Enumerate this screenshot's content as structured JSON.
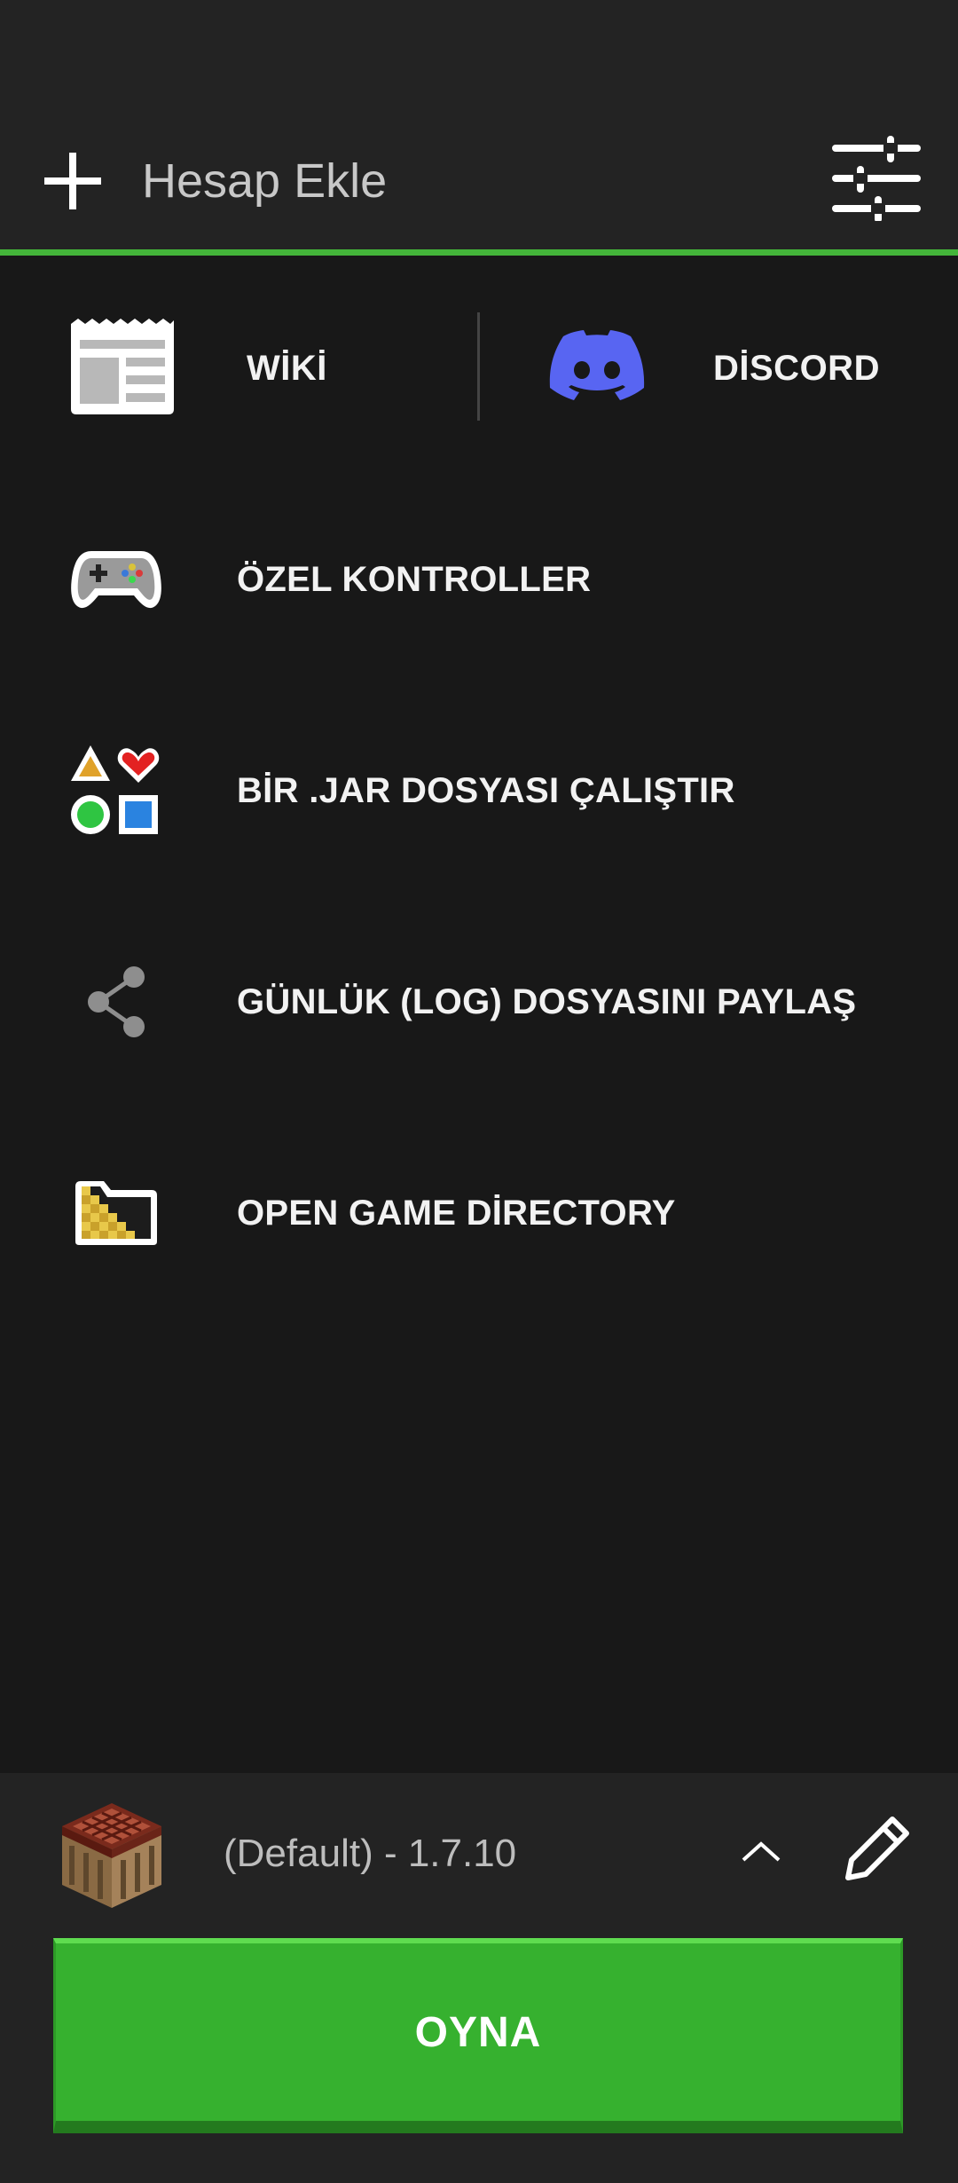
{
  "header": {
    "add_account_label": "Hesap Ekle",
    "accent_color": "#44b53a"
  },
  "quick_links": {
    "wiki_label": "WİKİ",
    "discord_label": "DİSCORD"
  },
  "menu": {
    "items": [
      {
        "label": "ÖZEL KONTROLLER",
        "icon": "gamepad-icon"
      },
      {
        "label": "BİR .JAR DOSYASI ÇALIŞTIR",
        "icon": "shapes-icon"
      },
      {
        "label": "GÜNLÜK (LOG) DOSYASINI PAYLAŞ",
        "icon": "share-icon"
      },
      {
        "label": "OPEN GAME DİRECTORY",
        "icon": "folder-icon"
      }
    ]
  },
  "profile": {
    "label": "(Default) - 1.7.10"
  },
  "play_button": {
    "label": "OYNA",
    "color": "#36b12f"
  }
}
